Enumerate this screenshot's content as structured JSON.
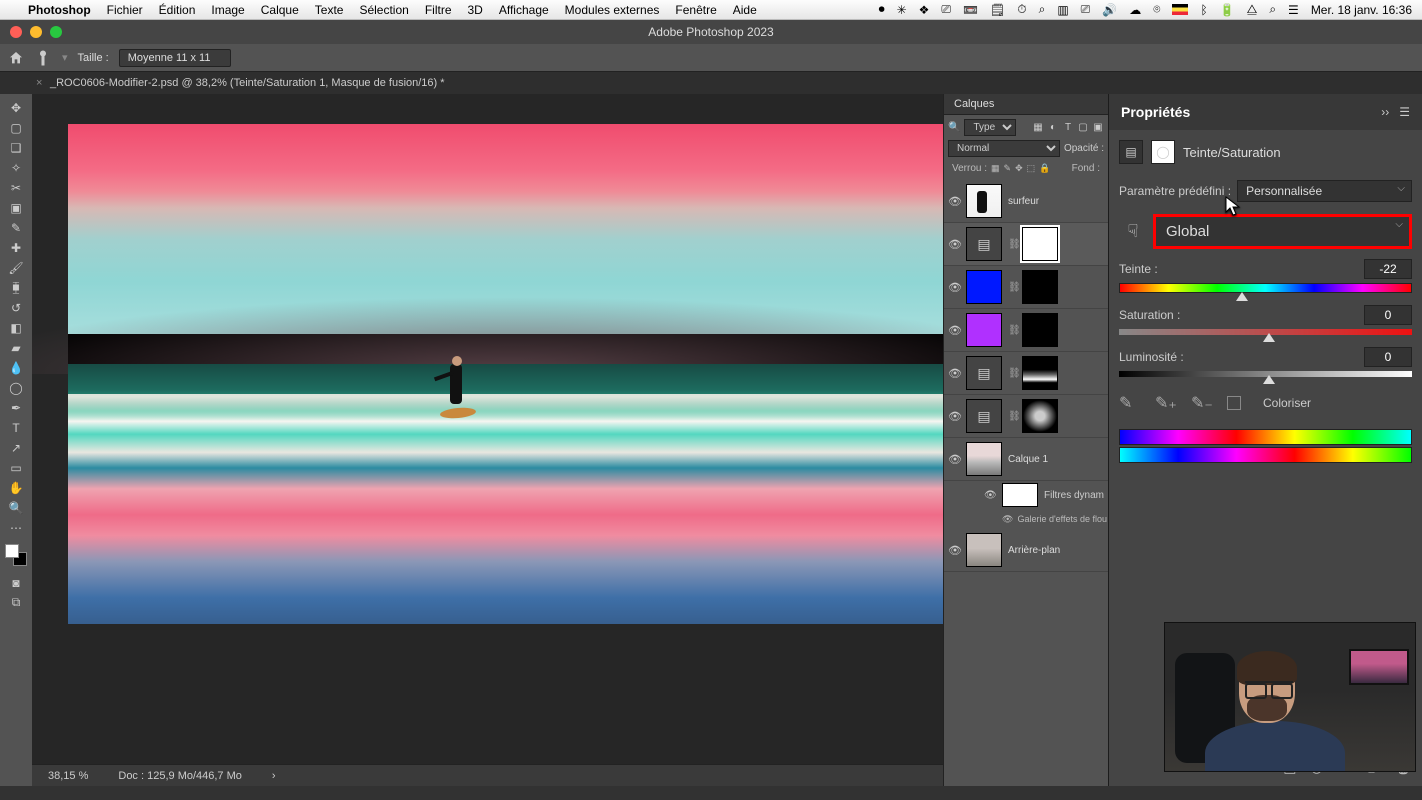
{
  "mac_menu": {
    "app": "Photoshop",
    "items": [
      "Fichier",
      "Édition",
      "Image",
      "Calque",
      "Texte",
      "Sélection",
      "Filtre",
      "3D",
      "Affichage",
      "Modules externes",
      "Fenêtre",
      "Aide"
    ],
    "clock": "Mer. 18 janv. 16:36"
  },
  "window_title": "Adobe Photoshop 2023",
  "option_bar": {
    "label_taille": "Taille :",
    "value_taille": "Moyenne 11 x 11"
  },
  "tab": {
    "title": "_ROC0606-Modifier-2.psd @ 38,2% (Teinte/Saturation 1, Masque de fusion/16) *"
  },
  "status": {
    "zoom": "38,15 %",
    "doc": "Doc : 125,9 Mo/446,7 Mo"
  },
  "layers_panel": {
    "title": "Calques",
    "type_label": "Type",
    "blend": "Normal",
    "opacity_label": "Opacité :",
    "lock_label": "Verrou :",
    "fill_label": "Fond :",
    "layers": {
      "surfeur": "surfeur",
      "calque1": "Calque 1",
      "filtres_dyn": "Filtres dynam",
      "galerie": "Galerie d'effets de flou",
      "arriere": "Arrière-plan"
    }
  },
  "props": {
    "title": "Propriétés",
    "adjustment": "Teinte/Saturation",
    "preset_label": "Paramètre prédéfini :",
    "preset_value": "Personnalisée",
    "range_value": "Global",
    "teinte_label": "Teinte :",
    "teinte_value": "-22",
    "saturation_label": "Saturation :",
    "saturation_value": "0",
    "luminosite_label": "Luminosité :",
    "luminosite_value": "0",
    "colorize": "Coloriser"
  }
}
